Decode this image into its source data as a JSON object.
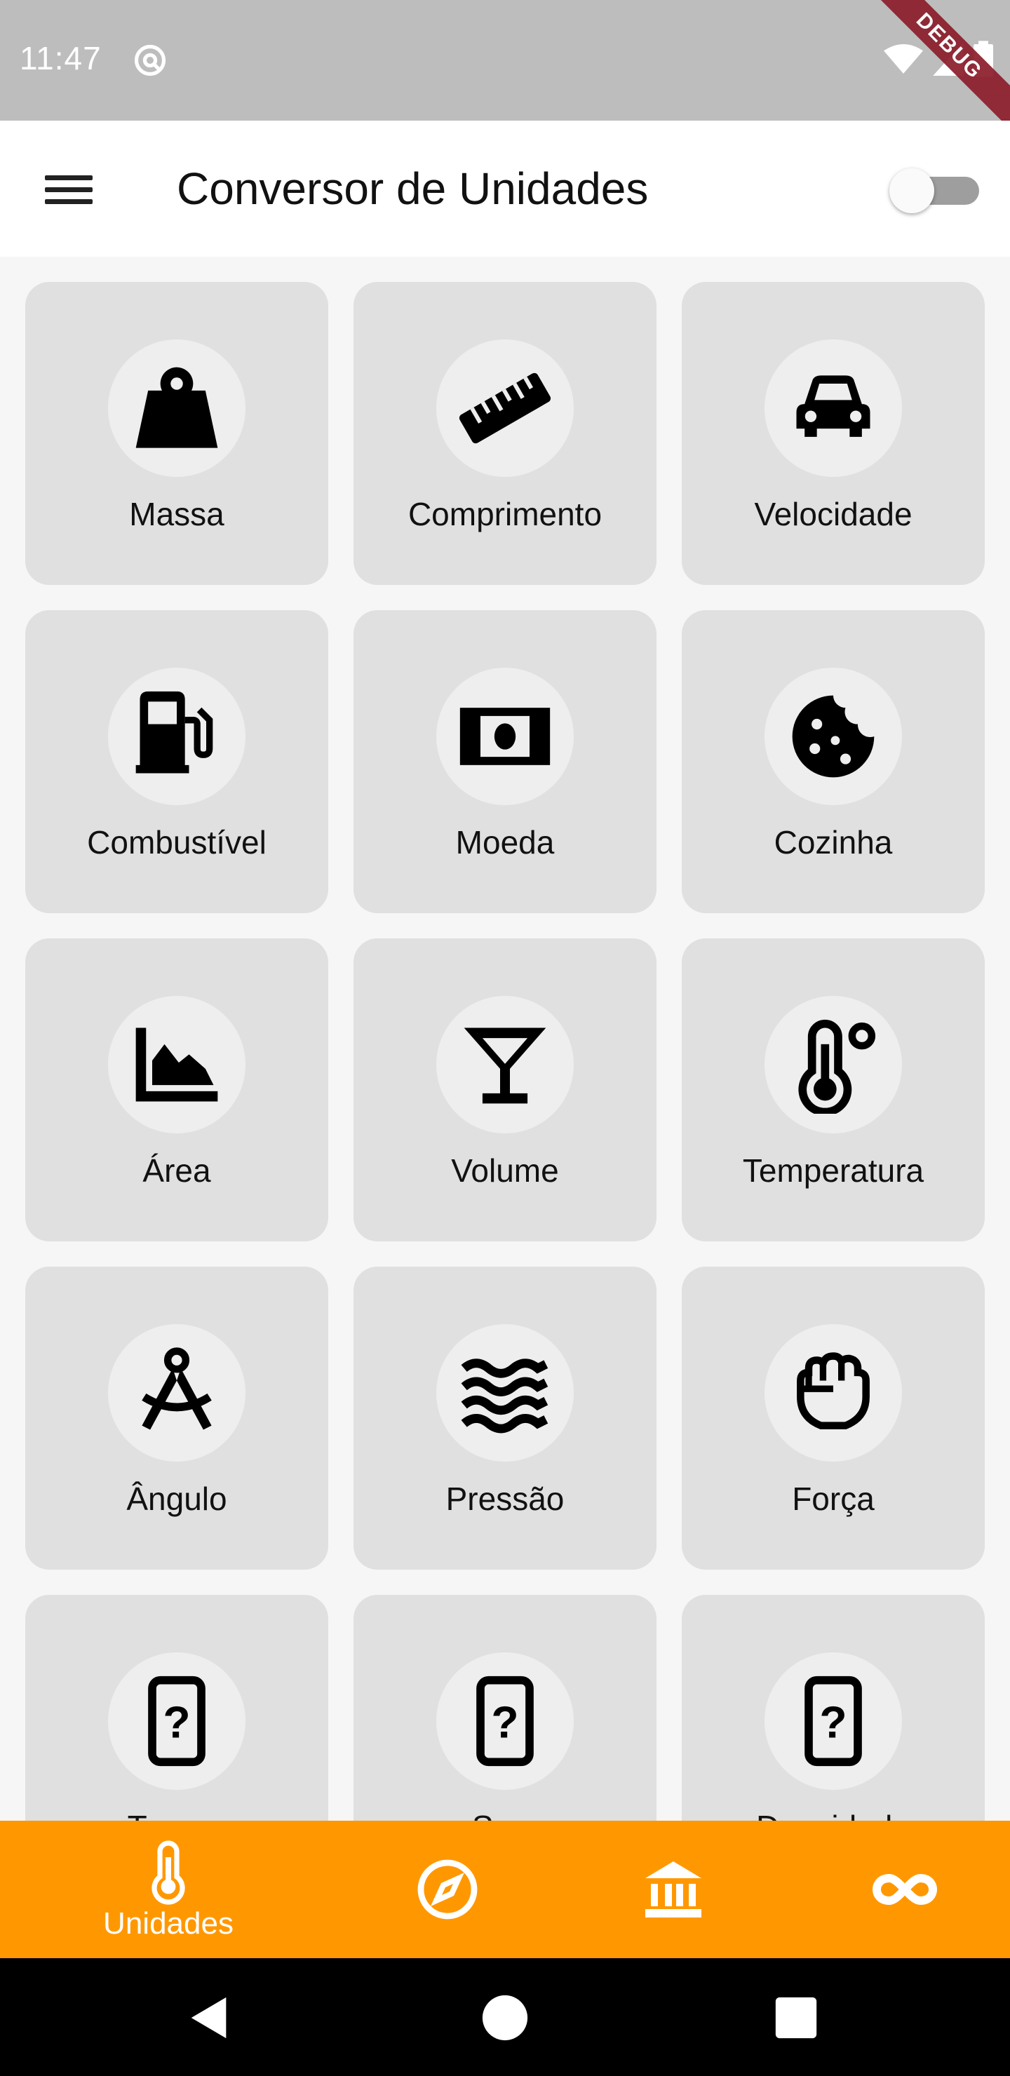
{
  "status_bar": {
    "time": "11:47",
    "debug_label": "DEBUG"
  },
  "app_bar": {
    "title": "Conversor de Unidades",
    "toggle_on": false
  },
  "categories": [
    {
      "label": "Massa",
      "icon": "weight-icon"
    },
    {
      "label": "Comprimento",
      "icon": "ruler-icon"
    },
    {
      "label": "Velocidade",
      "icon": "car-icon"
    },
    {
      "label": "Combustível",
      "icon": "gas-pump-icon"
    },
    {
      "label": "Moeda",
      "icon": "banknote-icon"
    },
    {
      "label": "Cozinha",
      "icon": "cookie-icon"
    },
    {
      "label": "Área",
      "icon": "area-chart-icon"
    },
    {
      "label": "Volume",
      "icon": "cocktail-glass-icon"
    },
    {
      "label": "Temperatura",
      "icon": "thermometer-icon"
    },
    {
      "label": "Ângulo",
      "icon": "compass-drafting-icon"
    },
    {
      "label": "Pressão",
      "icon": "waves-icon"
    },
    {
      "label": "Força",
      "icon": "fist-icon"
    },
    {
      "label": "Torque",
      "icon": "phone-question-icon"
    },
    {
      "label": "Som",
      "icon": "phone-question-icon"
    },
    {
      "label": "Densidade",
      "icon": "phone-question-icon"
    }
  ],
  "bottom_nav": {
    "items": [
      {
        "label": "Unidades",
        "icon": "thermometer-icon",
        "active": true
      },
      {
        "label": "",
        "icon": "compass-icon",
        "active": false
      },
      {
        "label": "",
        "icon": "bank-icon",
        "active": false
      },
      {
        "label": "",
        "icon": "infinity-icon",
        "active": false
      }
    ]
  },
  "colors": {
    "status_bar": "#bdbdbd",
    "app_bar": "#ffffff",
    "card": "#e0e0e0",
    "accent": "#ff9800",
    "system_nav": "#000000"
  }
}
